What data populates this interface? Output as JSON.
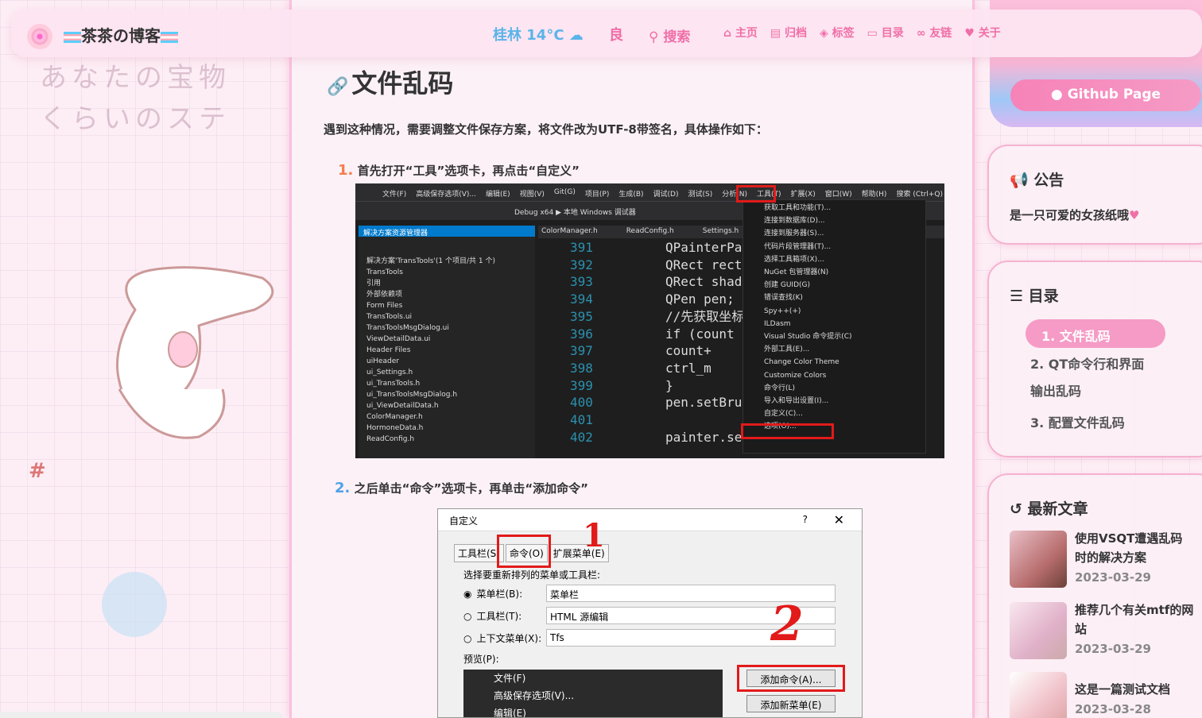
{
  "header": {
    "site_title": "茶茶の博客",
    "weather": "桂林 14°C",
    "aqi": "良",
    "search": "搜索",
    "nav": [
      "主页",
      "归档",
      "标签",
      "目录",
      "友链",
      "关于"
    ]
  },
  "post": {
    "section_title": "文件乱码",
    "intro": "遇到这种情况，需要调整文件保存方案，将文件改为UTF-8带签名，具体操作如下：",
    "step1_num": "1.",
    "step1": "首先打开“工具”选项卡，再点击“自定义”",
    "step2_num": "2.",
    "step2": "之后单击“命令”选项卡，再单击“添加命令”"
  },
  "vs_screenshot": {
    "menubar": [
      "文件(F)",
      "高级保存选项(V)...",
      "编辑(E)",
      "视图(V)",
      "Git(G)",
      "项目(P)",
      "生成(B)",
      "调试(D)",
      "测试(S)",
      "分析(N)",
      "工具(T)",
      "扩展(X)",
      "窗口(W)",
      "帮助(H)",
      "搜索 (Ctrl+Q)"
    ],
    "toolbar": "Debug   x64   ▶ 本地 Windows 调试器",
    "explorer_title": "解决方案资源管理器",
    "tree": [
      "解决方案'TransTools'(1 个项目/共 1 个)",
      "TransTools",
      "引用",
      "外部依赖项",
      "Form Files",
      "TransTools.ui",
      "TransToolsMsgDialog.ui",
      "ViewDetailData.ui",
      "Header Files",
      "uiHeader",
      "ui_Settings.h",
      "ui_TransTools.h",
      "ui_TransToolsMsgDialog.h",
      "ui_ViewDetailData.h",
      "ColorManager.h",
      "HormoneData.h",
      "ReadConfig.h"
    ],
    "tabs": [
      "ColorManager.h",
      "ReadConfig.h",
      "Settings.h"
    ],
    "line_numbers": [
      "391",
      "392",
      "393",
      "394",
      "395",
      "396",
      "397",
      "398",
      "399",
      "400",
      "401",
      "402"
    ],
    "code": [
      "QPainterPa",
      "QRect rect",
      "QRect shad",
      "QPen pen;",
      "//先获取坐标",
      "if (count",
      "    count+",
      "    ctrl_m",
      "}",
      "pen.setBru",
      "",
      "painter.se"
    ],
    "tools_menu": [
      "获取工具和功能(T)...",
      "连接到数据库(D)...",
      "连接到服务器(S)...",
      "代码片段管理器(T)...",
      "选择工具箱项(X)...",
      "NuGet 包管理器(N)",
      "创建 GUID(G)",
      "错误查找(K)",
      "Spy++(+)",
      "ILDasm",
      "Visual Studio 命令提示(C)",
      "外部工具(E)...",
      "Change Color Theme",
      "Customize Colors",
      "命令行(L)",
      "导入和导出设置(I)...",
      "自定义(C)...",
      "选项(O)..."
    ]
  },
  "dialog": {
    "title": "自定义",
    "help": "?",
    "close": "✕",
    "tabs": [
      "工具栏(S)",
      "命令(O)",
      "扩展菜单(E)"
    ],
    "prompt": "选择要重新排列的菜单或工具栏:",
    "opt_menubar": "菜单栏(B):",
    "opt_menubar_val": "菜单栏",
    "opt_toolbar": "工具栏(T):",
    "opt_toolbar_val": "HTML 源编辑",
    "opt_context": "上下文菜单(X):",
    "opt_context_val": "Tfs",
    "preview": "预览(P):",
    "preview_items": [
      "文件(F)",
      "高级保存选项(V)...",
      "编辑(E)"
    ],
    "btn_add_cmd": "添加命令(A)...",
    "btn_add_menu": "添加新菜单(E)",
    "mark1": "1",
    "mark2": "2"
  },
  "sidebar": {
    "github": "Github Page",
    "notice_title": "公告",
    "notice_text": "是一只可爱的女孩纸哦",
    "toc_title": "目录",
    "toc": [
      "1. 文件乱码",
      "2. QT命令行和界面",
      "输出乱码",
      "3. 配置文件乱码"
    ],
    "recent_title": "最新文章",
    "recent": [
      {
        "title": "使用VSQT遭遇乱码时的解决方案",
        "date": "2023-03-29"
      },
      {
        "title": "推荐几个有关mtf的网站",
        "date": "2023-03-29"
      },
      {
        "title": "这是一篇测试文档",
        "date": "2023-03-28"
      }
    ]
  },
  "background": {
    "jp_line1": "あなたの宝物",
    "jp_line2": "くらいのステ"
  }
}
